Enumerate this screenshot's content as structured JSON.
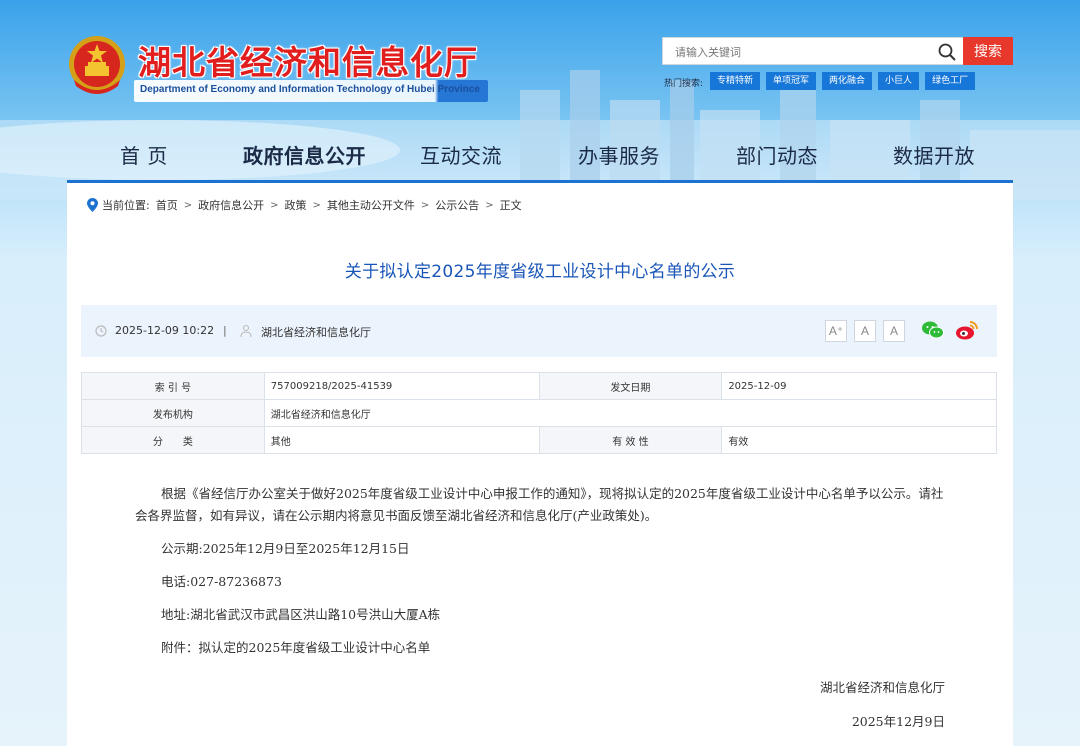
{
  "site": {
    "title": "湖北省经济和信息化厅",
    "subtitle": "Department of Economy and Information Technology of Hubei Province"
  },
  "search": {
    "placeholder": "请输入关键词",
    "button_label": "搜索",
    "hot_label": "热门搜索:",
    "hot_tags": [
      "专精特新",
      "单项冠军",
      "两化融合",
      "小巨人",
      "绿色工厂"
    ]
  },
  "nav": {
    "items": [
      "首 页",
      "政府信息公开",
      "互动交流",
      "办事服务",
      "部门动态",
      "数据开放"
    ],
    "active": "政府信息公开"
  },
  "breadcrumb": {
    "label": "当前位置:",
    "items": [
      "首页",
      "政府信息公开",
      "政策",
      "其他主动公开文件",
      "公示公告",
      "正文"
    ]
  },
  "article": {
    "title": "关于拟认定2025年度省级工业设计中心名单的公示",
    "publish_time": "2025-12-09 10:22",
    "divider": "|",
    "publisher": "湖北省经济和信息化厅",
    "font_buttons": [
      "A⁺",
      "A",
      "A"
    ]
  },
  "info_table": {
    "rows": [
      {
        "label1": "索 引 号",
        "value1": "757009218/2025-41539",
        "label2": "发文日期",
        "value2": "2025-12-09"
      },
      {
        "label1": "发布机构",
        "value1": "湖北省经济和信息化厅"
      },
      {
        "label1": "分　　类",
        "value1": "其他",
        "label2": "有 效 性",
        "value2": "有效"
      }
    ]
  },
  "body": {
    "para1": "根据《省经信厅办公室关于做好2025年度省级工业设计中心申报工作的通知》，现将拟认定的2025年度省级工业设计中心名单予以公示。请社会各界监督，如有异议，请在公示期内将意见书面反馈至湖北省经济和信息化厅(产业政策处)。",
    "period": "公示期:2025年12月9日至2025年12月15日",
    "phone": "电话:027-87236873",
    "address": "地址:湖北省武汉市武昌区洪山路10号洪山大厦A栋",
    "attachment": "附件：拟认定的2025年度省级工业设计中心名单",
    "signature": "湖北省经济和信息化厅",
    "date": "2025年12月9日"
  },
  "colors": {
    "brand_red": "#e11d1d",
    "nav_blue": "#1c72d0",
    "title_blue": "#1a56b8",
    "search_red": "#e8382c"
  }
}
